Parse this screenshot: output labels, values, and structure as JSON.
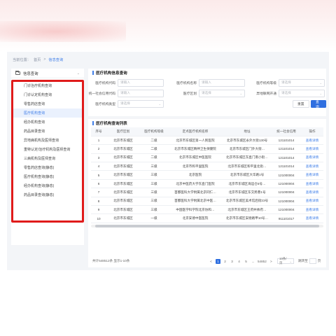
{
  "breadcrumb": {
    "prefix": "当前位置：",
    "home": "首页",
    "sep": ">",
    "current": "信息查询"
  },
  "sidebar": {
    "header": "信息查询",
    "items": [
      {
        "label": "门诊治疗机构查询",
        "active": false
      },
      {
        "label": "门诊认定机构查询",
        "active": false
      },
      {
        "label": "零售药店查询",
        "active": false
      },
      {
        "label": "医疗机构查询",
        "active": true
      },
      {
        "label": "经办机构查询",
        "active": false
      },
      {
        "label": "药品目录查询",
        "active": false
      },
      {
        "label": "异地病机构及医师查询",
        "active": false
      },
      {
        "label": "重特认定/治疗机构及医师查询",
        "active": false
      },
      {
        "label": "三病机构及医师查询",
        "active": false
      },
      {
        "label": "零售药店查询(静态)",
        "active": false
      },
      {
        "label": "医疗机构查询(静态)",
        "active": false
      },
      {
        "label": "经办机构查询(静态)",
        "active": false
      },
      {
        "label": "药品目录查询(静态)",
        "active": false
      }
    ]
  },
  "search": {
    "title": "医疗机构信息查询",
    "fields": {
      "code": {
        "label": "医疗机构代码",
        "placeholder": "请输入"
      },
      "name": {
        "label": "医疗机构名称",
        "placeholder": "请输入"
      },
      "level": {
        "label": "医疗机构等级",
        "placeholder": "请选择"
      },
      "credit": {
        "label": "统一社会信用代码",
        "placeholder": "请输入"
      },
      "area": {
        "label": "医疗区划",
        "placeholder": "请选择"
      },
      "remote": {
        "label": "异地联网开通",
        "placeholder": "请选择"
      },
      "type": {
        "label": "医疗机构类型",
        "placeholder": "请选择"
      }
    },
    "reset_label": "重置",
    "query_label": "查询"
  },
  "results": {
    "title": "医疗机构查询列表",
    "columns": [
      "序号",
      "医疗区划",
      "医疗机构等级",
      "定点医疗机构名称",
      "地址",
      "统一社会信用",
      "操作"
    ],
    "rows": [
      [
        "1",
        "北京市东城区",
        "二级",
        "北京市东城区第一人民医院",
        "北京市东城区永外大街130号",
        "121101014",
        "查看详情"
      ],
      [
        "2",
        "北京市东城区",
        "二级",
        "北京市东城区精神卫生保健院",
        "北京市东城区门外大街…",
        "121101014",
        "查看详情"
      ],
      [
        "3",
        "北京市东城区",
        "二级",
        "北京市东城区中医医院",
        "北京市东城区东直门南小街…",
        "121101014",
        "查看详情"
      ],
      [
        "4",
        "北京市东城区",
        "三级",
        "北京市和平里医院",
        "北京市东城区和平里北街…",
        "121101014",
        "查看详情"
      ],
      [
        "5",
        "北京市东城区",
        "三级",
        "北京医院",
        "北京市东城区大华路1号",
        "121000004",
        "查看详情"
      ],
      [
        "6",
        "北京市东城区",
        "三级",
        "北京中医药大学东直门医院",
        "北京市东城区海运仓5号…",
        "121000004",
        "查看详情"
      ],
      [
        "7",
        "北京市东城区",
        "三级",
        "首都医科大学附属北京同仁…",
        "北京市东城区东交民巷1号",
        "121000004",
        "查看详情"
      ],
      [
        "8",
        "北京市东城区",
        "三级",
        "首都医科大学附属北京中医…",
        "北京市东城区美术馆后街23号",
        "121000004",
        "查看详情"
      ],
      [
        "9",
        "北京市东城区",
        "三级",
        "中国医学科学院北京协和…",
        "北京市东城区王府井帅府…",
        "121000004",
        "查看详情"
      ],
      [
        "10",
        "北京市东城区",
        "一级",
        "北京安德中医医院",
        "北京市东城区安德路甲10号…",
        "911101017",
        "查看详情"
      ]
    ]
  },
  "pagination": {
    "total_text": "共计548512条 显示1-10条",
    "pages": [
      "1",
      "2",
      "3",
      "4",
      "5",
      "...",
      "54852"
    ],
    "prev": "<",
    "next": ">",
    "page_size": "10条/页",
    "jump_label": "跳转至",
    "jump_suffix": "页"
  },
  "colors": {
    "accent": "#2f6fe0",
    "highlight_border": "#e01b1b",
    "active_bg": "#eaf1fd"
  }
}
